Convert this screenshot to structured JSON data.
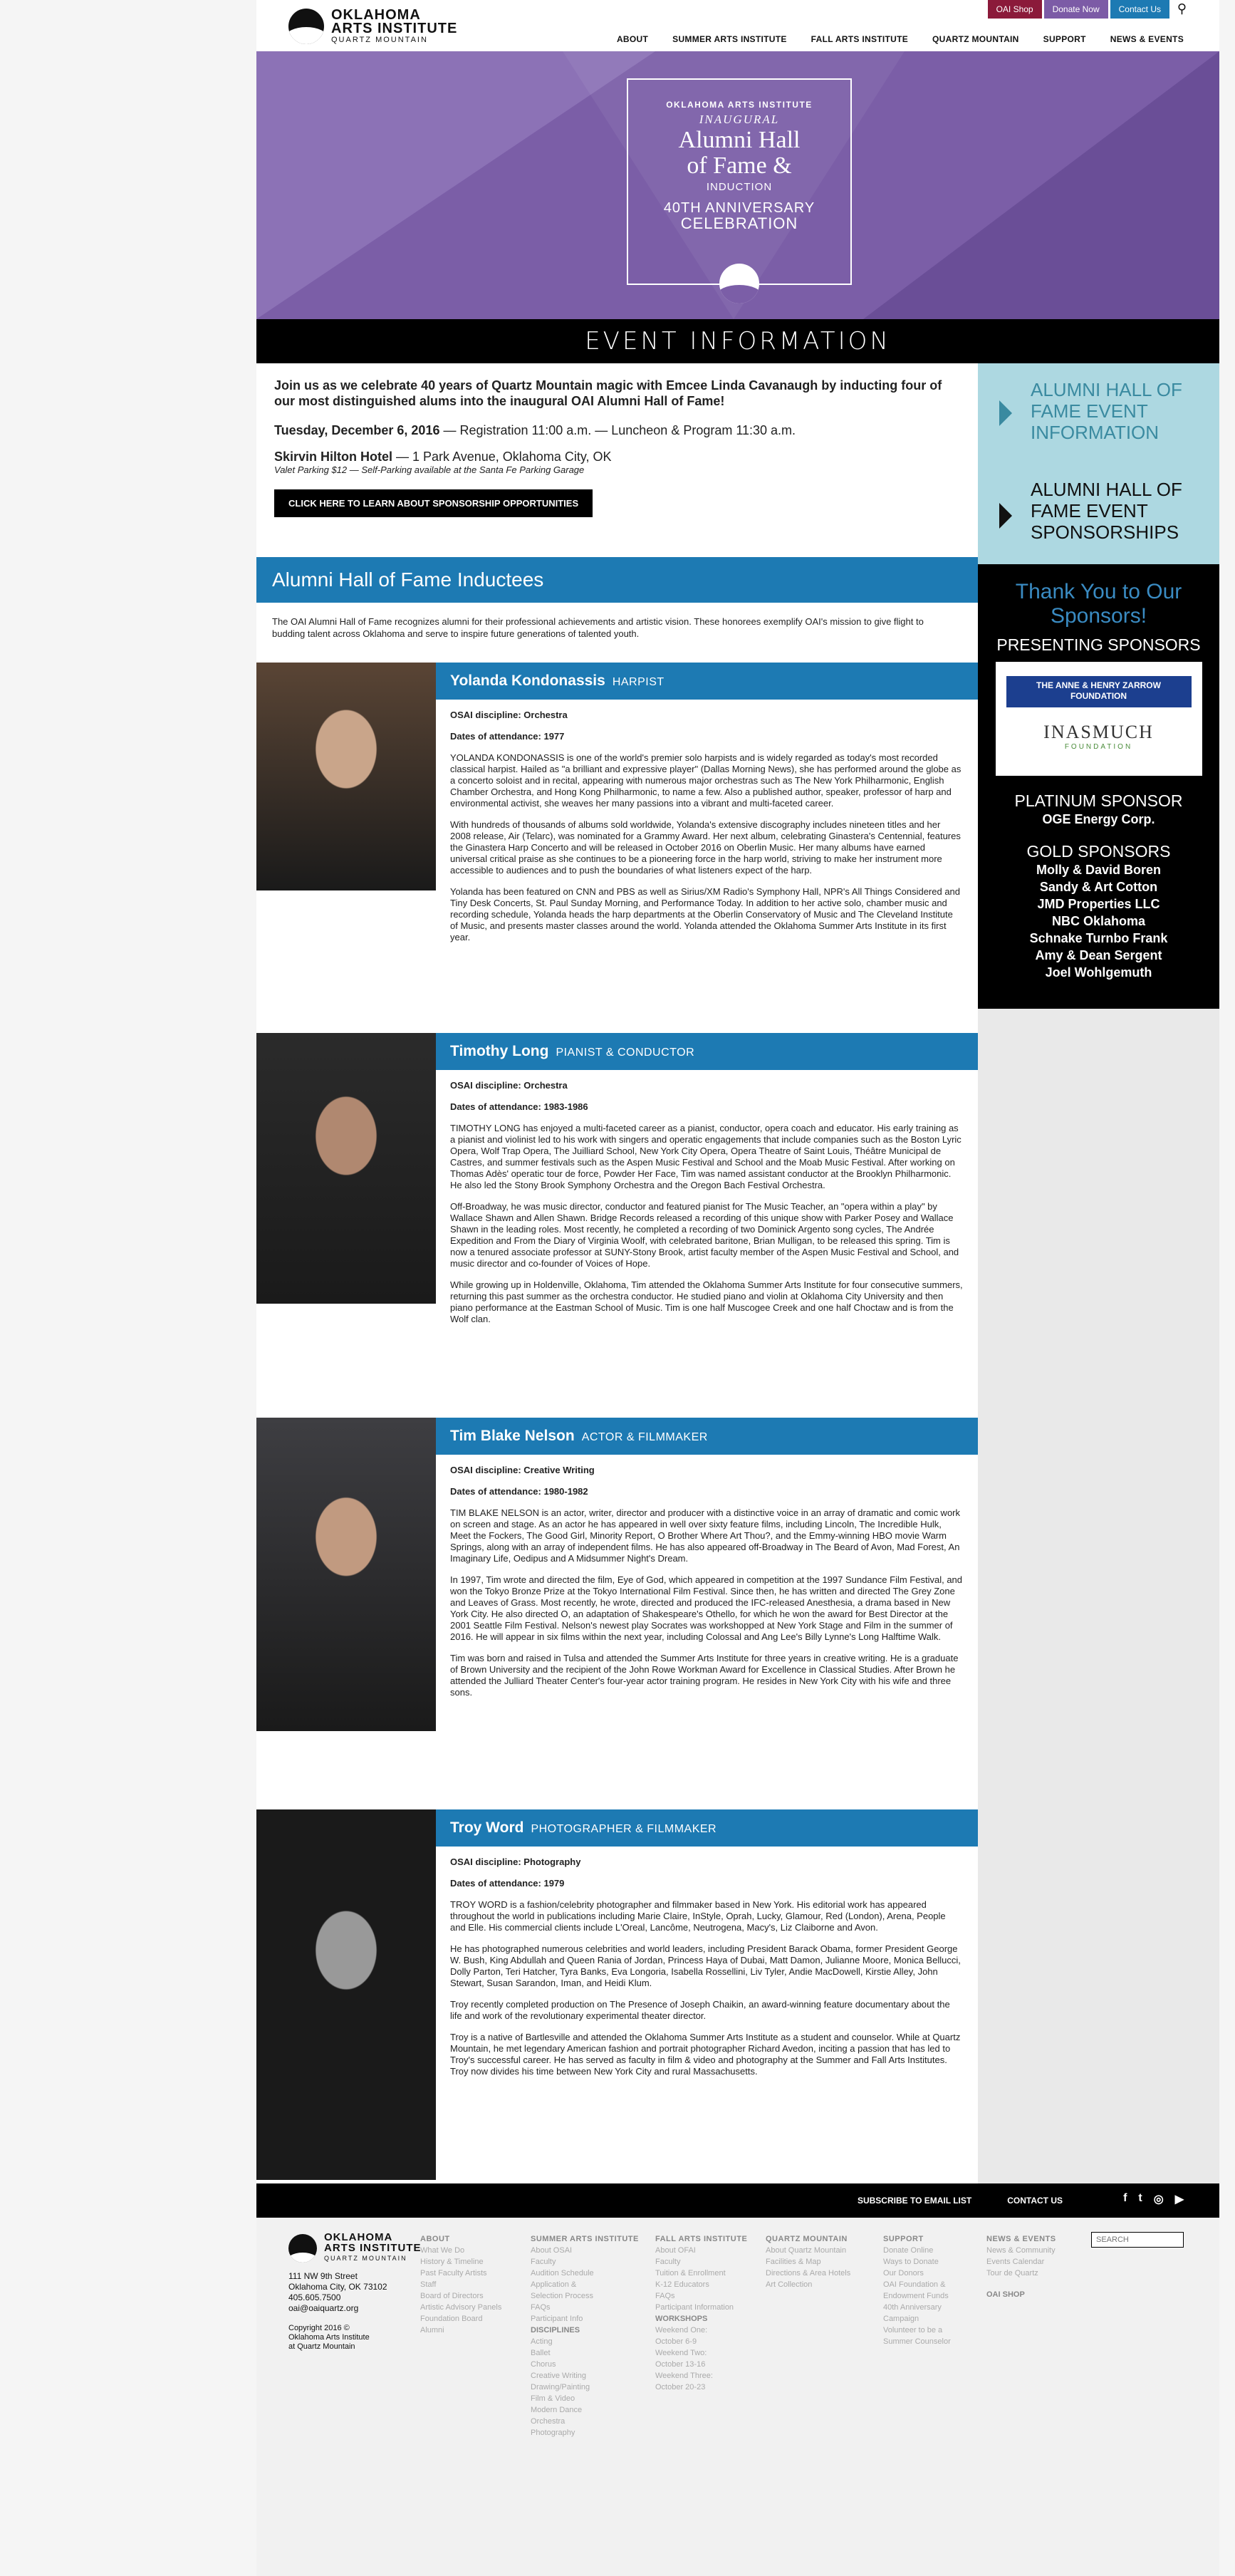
{
  "header": {
    "logo_line1": "OKLAHOMA",
    "logo_line2": "ARTS INSTITUTE",
    "logo_line3": "QUARTZ MOUNTAIN",
    "top_buttons": [
      {
        "label": "OAI Shop",
        "color": "#8b1a3a"
      },
      {
        "label": "Donate Now",
        "color": "#7c5ba6"
      },
      {
        "label": "Contact Us",
        "color": "#1d7ab3"
      }
    ],
    "nav": [
      "ABOUT",
      "SUMMER ARTS INSTITUTE",
      "FALL ARTS INSTITUTE",
      "QUARTZ MOUNTAIN",
      "SUPPORT",
      "NEWS & EVENTS"
    ]
  },
  "hero": {
    "line1": "OKLAHOMA ARTS INSTITUTE",
    "line2": "INAUGURAL",
    "line3a": "Alumni Hall",
    "line3b": "of Fame &",
    "line4": "INDUCTION",
    "line5": "40TH ANNIVERSARY",
    "line6": "CELEBRATION"
  },
  "event_bar": "EVENT INFORMATION",
  "intro": {
    "lead": "Join us as we celebrate 40 years of Quartz Mountain magic with Emcee Linda Cavanaugh by inducting four of our most distinguished alums into the inaugural OAI Alumni Hall of Fame!",
    "date_bold": "Tuesday, December 6, 2016",
    "date_rest": " — Registration 11:00 a.m. — Luncheon & Program 11:30 a.m.",
    "venue_bold": "Skirvin Hilton Hotel",
    "venue_rest": " — 1 Park Avenue, Oklahoma City, OK",
    "valet": "Valet Parking $12 — Self-Parking available at the Santa Fe Parking Garage",
    "button": "CLICK HERE TO LEARN ABOUT SPONSORSHIP OPPORTUNITIES"
  },
  "section": {
    "title": "Alumni Hall of Fame Inductees",
    "desc": "The OAI Alumni Hall of Fame recognizes alumni for their professional achievements and artistic vision. These honorees exemplify OAI's mission to give flight to budding talent across Oklahoma and serve to inspire future generations of talented youth."
  },
  "inductees": [
    {
      "name": "Yolanda Kondonassis",
      "role": "HARPIST",
      "discipline": "OSAI discipline: Orchestra",
      "dates": "Dates of attendance: 1977",
      "paras": [
        "YOLANDA KONDONASSIS is one of the world's premier solo harpists and is widely regarded as today's most recorded classical harpist. Hailed as \"a brilliant and expressive player\" (Dallas Morning News), she has performed around the globe as a concerto soloist and in recital, appearing with numerous major orchestras such as The New York Philharmonic, English Chamber Orchestra, and Hong Kong Philharmonic, to name a few. Also a published author, speaker, professor of harp and environmental activist, she weaves her many passions into a vibrant and multi-faceted career.",
        "With hundreds of thousands of albums sold worldwide, Yolanda's extensive discography includes nineteen titles and her 2008 release, Air (Telarc), was nominated for a Grammy Award. Her next album, celebrating Ginastera's Centennial, features the Ginastera Harp Concerto and will be released in October 2016 on Oberlin Music. Her many albums have earned universal critical praise as she continues to be a pioneering force in the harp world, striving to make her instrument more accessible to audiences and to push the boundaries of what listeners expect of the harp.",
        "Yolanda has been featured on CNN and PBS as well as Sirius/XM Radio's Symphony Hall, NPR's All Things Considered and Tiny Desk Concerts, St. Paul Sunday Morning, and Performance Today. In addition to her active solo, chamber music and recording schedule, Yolanda heads the harp departments at the Oberlin Conservatory of Music and The Cleveland Institute of Music, and presents master classes around the world. Yolanda attended the Oklahoma Summer Arts Institute in its first year."
      ]
    },
    {
      "name": "Timothy Long",
      "role": "PIANIST & CONDUCTOR",
      "discipline": "OSAI discipline: Orchestra",
      "dates": "Dates of attendance: 1983-1986",
      "paras": [
        "TIMOTHY LONG has enjoyed a multi-faceted career as a pianist, conductor, opera coach and educator. His early training as a pianist and violinist led to his work with singers and operatic engagements that include companies such as the Boston Lyric Opera, Wolf Trap Opera, The Juilliard School, New York City Opera, Opera Theatre of Saint Louis, Théâtre Municipal de Castres, and summer festivals such as the Aspen Music Festival and School and the Moab Music Festival. After working on Thomas Adès' operatic tour de force, Powder Her Face, Tim was named assistant conductor at the Brooklyn Philharmonic. He also led the Stony Brook Symphony Orchestra and the Oregon Bach Festival Orchestra.",
        "Off-Broadway, he was music director, conductor and featured pianist for The Music Teacher, an \"opera within a play\" by Wallace Shawn and Allen Shawn. Bridge Records released a recording of this unique show with Parker Posey and Wallace Shawn in the leading roles. Most recently, he completed a recording of two Dominick Argento song cycles, The Andrée Expedition and From the Diary of Virginia Woolf, with celebrated baritone, Brian Mulligan, to be released this spring. Tim is now a tenured associate professor at SUNY-Stony Brook, artist faculty member of the Aspen Music Festival and School, and music director and co-founder of Voices of Hope.",
        "While growing up in Holdenville, Oklahoma, Tim attended the Oklahoma Summer Arts Institute for four consecutive summers, returning this past summer as the orchestra conductor. He studied piano and violin at Oklahoma City University and then piano performance at the Eastman School of Music. Tim is one half Muscogee Creek and one half Choctaw and is from the Wolf clan."
      ]
    },
    {
      "name": "Tim Blake Nelson",
      "role": "ACTOR & FILMMAKER",
      "discipline": "OSAI discipline: Creative Writing",
      "dates": "Dates of attendance: 1980-1982",
      "paras": [
        "TIM BLAKE NELSON is an actor, writer, director and producer with a distinctive voice in an array of dramatic and comic work on screen and stage. As an actor he has appeared in well over sixty feature films, including Lincoln, The Incredible Hulk, Meet the Fockers, The Good Girl, Minority Report, O Brother Where Art Thou?, and the Emmy-winning HBO movie Warm Springs, along with an array of independent films. He has also appeared off-Broadway in The Beard of Avon, Mad Forest, An Imaginary Life, Oedipus and A Midsummer Night's Dream.",
        "In 1997, Tim wrote and directed the film, Eye of God, which appeared in competition at the 1997 Sundance Film Festival, and won the Tokyo Bronze Prize at the Tokyo International Film Festival. Since then, he has written and directed The Grey Zone and Leaves of Grass. Most recently, he wrote, directed and produced the IFC-released Anesthesia, a drama based in New York City. He also directed O, an adaptation of Shakespeare's Othello, for which he won the award for Best Director at the 2001 Seattle Film Festival. Nelson's newest play Socrates was workshopped at New York Stage and Film in the summer of 2016. He will appear in six films within the next year, including Colossal and Ang Lee's Billy Lynne's Long Halftime Walk.",
        "Tim was born and raised in Tulsa and attended the Summer Arts Institute for three years in creative writing. He is a graduate of Brown University and the recipient of the John Rowe Workman Award for Excellence in Classical Studies. After Brown he attended the Julliard Theater Center's four-year actor training program. He resides in New York City with his wife and three sons."
      ]
    },
    {
      "name": "Troy Word",
      "role": "PHOTOGRAPHER & FILMMAKER",
      "discipline": "OSAI discipline: Photography",
      "dates": "Dates of attendance: 1979",
      "paras": [
        "TROY WORD is a fashion/celebrity photographer and filmmaker based in New York. His editorial work has appeared throughout the world in publications including Marie Claire, InStyle, Oprah, Lucky, Glamour, Red (London), Arena, People and Elle. His commercial clients include L'Oreal, Lancôme, Neutrogena, Macy's, Liz Claiborne and Avon.",
        "He has photographed numerous celebrities and world leaders, including President Barack Obama, former President George W. Bush, King Abdullah and Queen Rania of Jordan, Princess Haya of Dubai, Matt Damon, Julianne Moore, Monica Bellucci, Dolly Parton, Teri Hatcher, Tyra Banks, Eva Longoria, Isabella Rossellini, Liv Tyler, Andie MacDowell, Kirstie Alley, John Stewart, Susan Sarandon, Iman, and Heidi Klum.",
        "Troy recently completed production on The Presence of Joseph Chaikin, an award-winning feature documentary about the life and work of the revolutionary experimental theater director.",
        "Troy is a native of Bartlesville and attended the Oklahoma Summer Arts Institute as a student and counselor. While at Quartz Mountain, he met legendary American fashion and portrait photographer Richard Avedon, inciting a passion that has led to Troy's successful career. He has served as faculty in film & video and photography at the Summer and Fall Arts Institutes. Troy now divides his time between New York City and rural Massachusetts."
      ]
    }
  ],
  "sidebar": {
    "item1": "ALUMNI HALL OF FAME EVENT INFORMATION",
    "item2": "ALUMNI HALL OF FAME EVENT SPONSORSHIPS",
    "thanks": "Thank You to Our Sponsors!",
    "presenting": "PRESENTING SPONSORS",
    "zarrow1": "THE ANNE & HENRY ZARROW",
    "zarrow2": "FOUNDATION",
    "inasmuch": "INASMUCH",
    "inasmuch_sub": "FOUNDATION",
    "platinum": "PLATINUM SPONSOR",
    "platinum_name": "OGE Energy Corp.",
    "gold": "GOLD SPONSORS",
    "gold_names": [
      "Molly & David Boren",
      "Sandy & Art Cotton",
      "JMD Properties LLC",
      "NBC Oklahoma",
      "Schnake Turnbo Frank",
      "Amy & Dean Sergent",
      "Joel Wohlgemuth"
    ]
  },
  "footbar": {
    "links": [
      "SUBSCRIBE TO EMAIL LIST",
      "CONTACT US"
    ],
    "social": [
      "f",
      "t",
      "◎",
      "▶"
    ]
  },
  "footer": {
    "address": [
      "111 NW 9th Street",
      "Oklahoma City, OK 73102",
      "405.605.7500",
      "oai@oaiquartz.org"
    ],
    "copyright": [
      "Copyright 2016 ©",
      "Oklahoma Arts Institute",
      "at Quartz Mountain"
    ],
    "cols": [
      {
        "h": "ABOUT",
        "items": [
          "What We Do",
          "History & Timeline",
          "Past Faculty Artists",
          "Staff",
          "Board of Directors",
          "Artistic Advisory Panels",
          "Foundation Board",
          "Alumni"
        ]
      },
      {
        "h": "SUMMER ARTS INSTITUTE",
        "items": [
          "About OSAI",
          "Faculty",
          "Audition Schedule",
          "Application &",
          "Selection Process",
          "FAQs",
          "Participant Info",
          "DISCIPLINES",
          "Acting",
          "Ballet",
          "Chorus",
          "Creative Writing",
          "Drawing/Painting",
          "Film & Video",
          "Modern Dance",
          "Orchestra",
          "Photography"
        ]
      },
      {
        "h": "FALL ARTS INSTITUTE",
        "items": [
          "About OFAI",
          "Faculty",
          "Tuition & Enrollment",
          "K-12 Educators",
          "FAQs",
          "Participant Information",
          "WORKSHOPS",
          "Weekend One:",
          "October 6-9",
          "Weekend Two:",
          "October 13-16",
          "Weekend Three:",
          "October 20-23"
        ]
      },
      {
        "h": "QUARTZ MOUNTAIN",
        "items": [
          "About Quartz Mountain",
          "Facilities & Map",
          "Directions & Area Hotels",
          "Art Collection"
        ]
      },
      {
        "h": "SUPPORT",
        "items": [
          "Donate Online",
          "Ways to Donate",
          "Our Donors",
          "OAI Foundation &",
          "Endowment Funds",
          "40th Anniversary",
          "Campaign",
          "Volunteer to be a",
          "Summer Counselor"
        ]
      },
      {
        "h": "NEWS & EVENTS",
        "items": [
          "News & Community",
          "Events Calendar",
          "Tour de Quartz",
          "",
          "OAI SHOP"
        ]
      }
    ],
    "search_placeholder": "SEARCH"
  }
}
